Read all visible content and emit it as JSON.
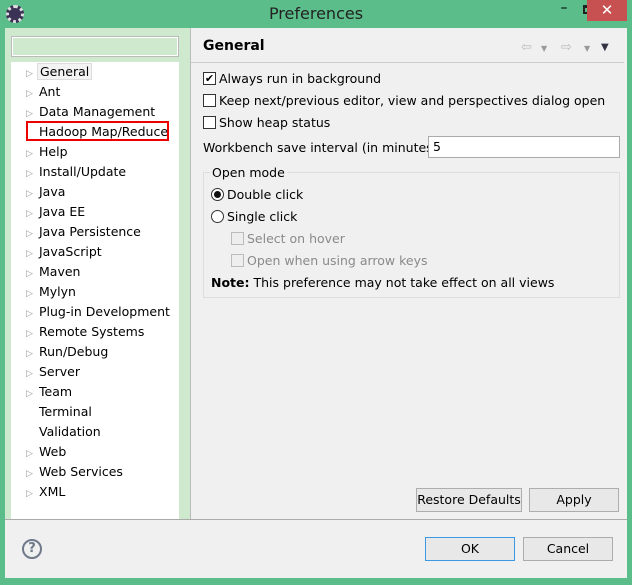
{
  "window": {
    "title": "Preferences",
    "minimize": "–",
    "close": "✕"
  },
  "filter": {
    "value": ""
  },
  "tree": [
    {
      "label": "General",
      "expandable": true,
      "selected": true
    },
    {
      "label": "Ant",
      "expandable": true
    },
    {
      "label": "Data Management",
      "expandable": true
    },
    {
      "label": "Hadoop Map/Reduce",
      "expandable": false,
      "highlighted": true
    },
    {
      "label": "Help",
      "expandable": true
    },
    {
      "label": "Install/Update",
      "expandable": true
    },
    {
      "label": "Java",
      "expandable": true
    },
    {
      "label": "Java EE",
      "expandable": true
    },
    {
      "label": "Java Persistence",
      "expandable": true
    },
    {
      "label": "JavaScript",
      "expandable": true
    },
    {
      "label": "Maven",
      "expandable": true
    },
    {
      "label": "Mylyn",
      "expandable": true
    },
    {
      "label": "Plug-in Development",
      "expandable": true
    },
    {
      "label": "Remote Systems",
      "expandable": true
    },
    {
      "label": "Run/Debug",
      "expandable": true
    },
    {
      "label": "Server",
      "expandable": true
    },
    {
      "label": "Team",
      "expandable": true
    },
    {
      "label": "Terminal",
      "expandable": false
    },
    {
      "label": "Validation",
      "expandable": false
    },
    {
      "label": "Web",
      "expandable": true
    },
    {
      "label": "Web Services",
      "expandable": true
    },
    {
      "label": "XML",
      "expandable": true
    }
  ],
  "page": {
    "title": "General",
    "always_run": {
      "label": "Always run in background",
      "checked": true
    },
    "keep_next": {
      "label": "Keep next/previous editor, view and perspectives dialog open",
      "checked": false
    },
    "heap": {
      "label": "Show heap status",
      "checked": false
    },
    "interval_label": "Workbench save interval (in minutes):",
    "interval_value": "5",
    "open_mode": {
      "label": "Open mode",
      "double": "Double click",
      "single": "Single click",
      "hover": "Select on hover",
      "arrow": "Open when using arrow keys",
      "selected": "Double click"
    },
    "note_bold": "Note:",
    "note": " This preference may not take effect on all views",
    "restore": "Restore Defaults",
    "apply": "Apply"
  },
  "footer": {
    "ok": "OK",
    "cancel": "Cancel",
    "help": "?"
  },
  "colors": {
    "frame": "#5bbd8a",
    "close": "#c75050",
    "highlight": "#ee0000"
  }
}
